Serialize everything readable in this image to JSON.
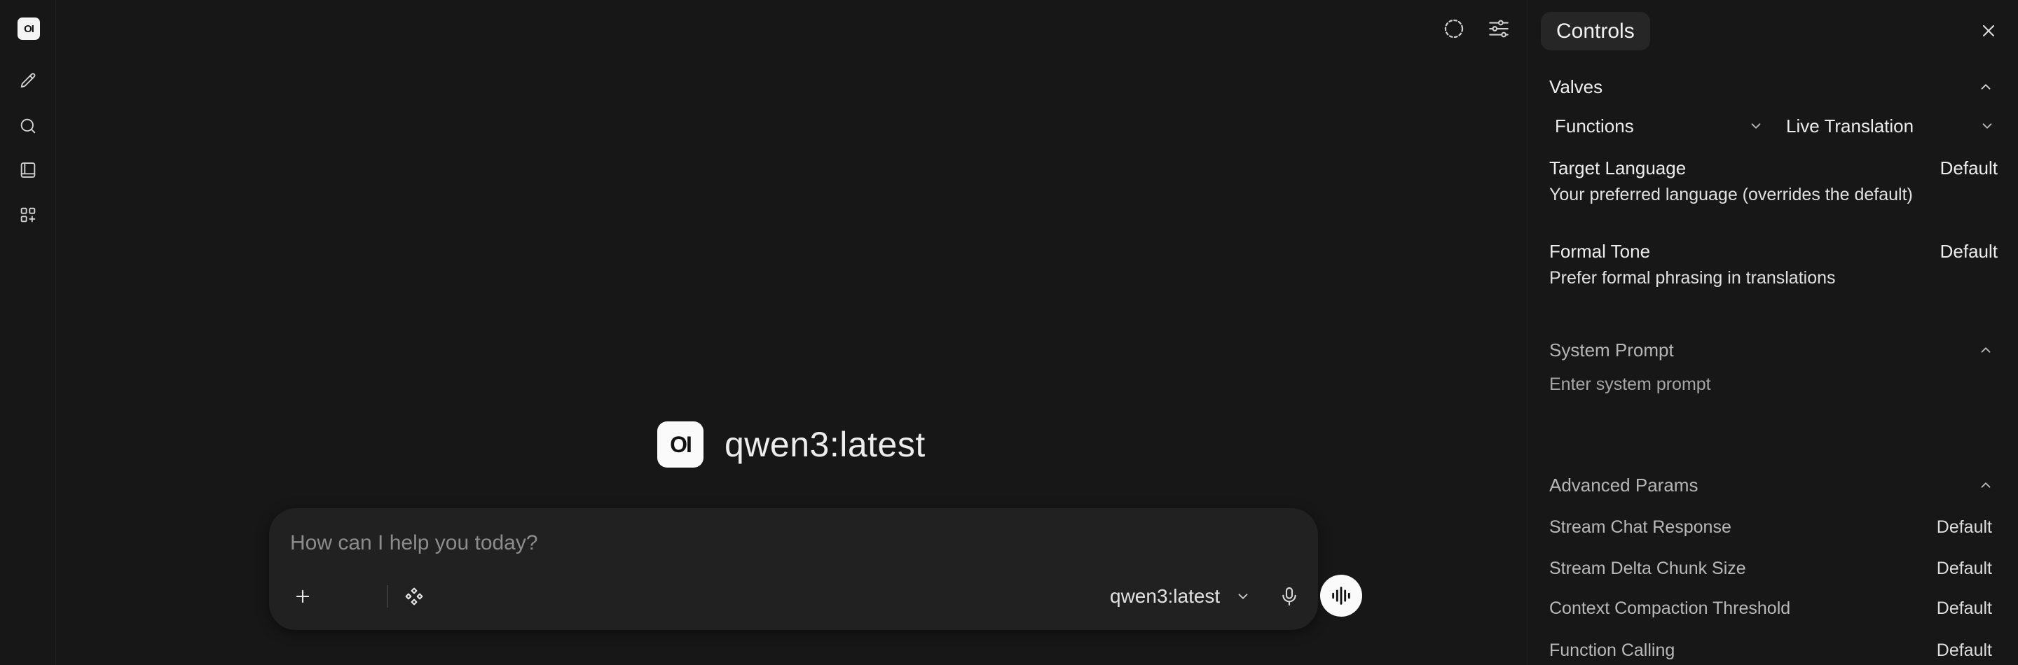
{
  "rail": {
    "logo_text": "OI",
    "items": [
      {
        "icon": "pencil-icon",
        "label": "New chat"
      },
      {
        "icon": "search-icon",
        "label": "Search"
      },
      {
        "icon": "notebook-icon",
        "label": "Notes"
      },
      {
        "icon": "apps-icon",
        "label": "Workspace"
      }
    ]
  },
  "main": {
    "top_icons": [
      "temporary-chat-icon",
      "controls-sliders-icon"
    ],
    "hero": {
      "logo_text": "OI",
      "model_name": "qwen3:latest"
    },
    "composer": {
      "placeholder": "How can I help you today?",
      "model_label": "qwen3:latest"
    }
  },
  "panel": {
    "title": "Controls",
    "valves": {
      "heading": "Valves",
      "type_select": "Functions",
      "function_select": "Live Translation",
      "rows": [
        {
          "name": "Target Language",
          "value": "Default",
          "description": "Your preferred language (overrides the default)"
        },
        {
          "name": "Formal Tone",
          "value": "Default",
          "description": "Prefer formal phrasing in translations"
        }
      ]
    },
    "system_prompt": {
      "heading": "System Prompt",
      "placeholder": "Enter system prompt"
    },
    "advanced": {
      "heading": "Advanced Params",
      "rows": [
        {
          "name": "Stream Chat Response",
          "value": "Default"
        },
        {
          "name": "Stream Delta Chunk Size",
          "value": "Default"
        },
        {
          "name": "Context Compaction Threshold",
          "value": "Default"
        },
        {
          "name": "Function Calling",
          "value": "Default"
        }
      ]
    }
  },
  "colors": {
    "background": "#171717",
    "composer": "#212121",
    "panel_title_bg": "#262626",
    "accent_white": "#fafafa"
  }
}
